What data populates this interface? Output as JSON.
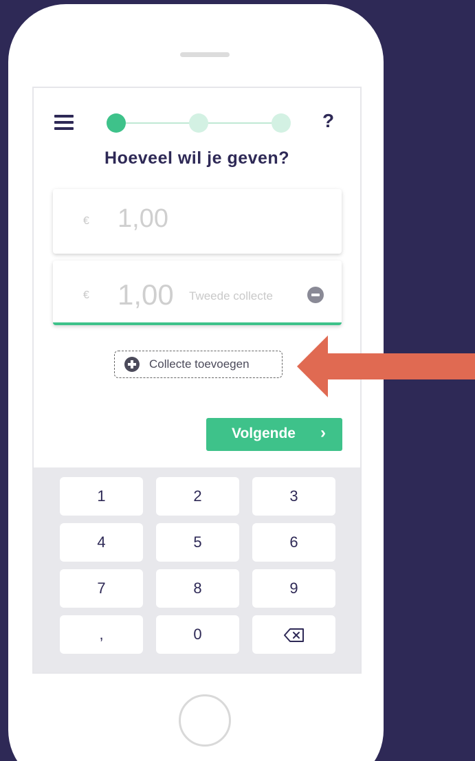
{
  "header": {
    "title": "Hoeveel wil je geven?",
    "help_label": "?",
    "steps_total": 3,
    "step_current": 1
  },
  "amounts": [
    {
      "currency": "€",
      "value": "1,00"
    },
    {
      "currency": "€",
      "value": "1,00",
      "label": "Tweede collecte"
    }
  ],
  "add_collect": {
    "label": "Collecte toevoegen"
  },
  "next_button": {
    "label": "Volgende",
    "icon": "chevron-right-icon"
  },
  "keypad": {
    "keys": [
      "1",
      "2",
      "3",
      "4",
      "5",
      "6",
      "7",
      "8",
      "9",
      ",",
      "0",
      ""
    ]
  },
  "colors": {
    "background": "#2e2956",
    "accent": "#3ec28a",
    "arrow": "#e06a52",
    "text": "#2e2956"
  }
}
